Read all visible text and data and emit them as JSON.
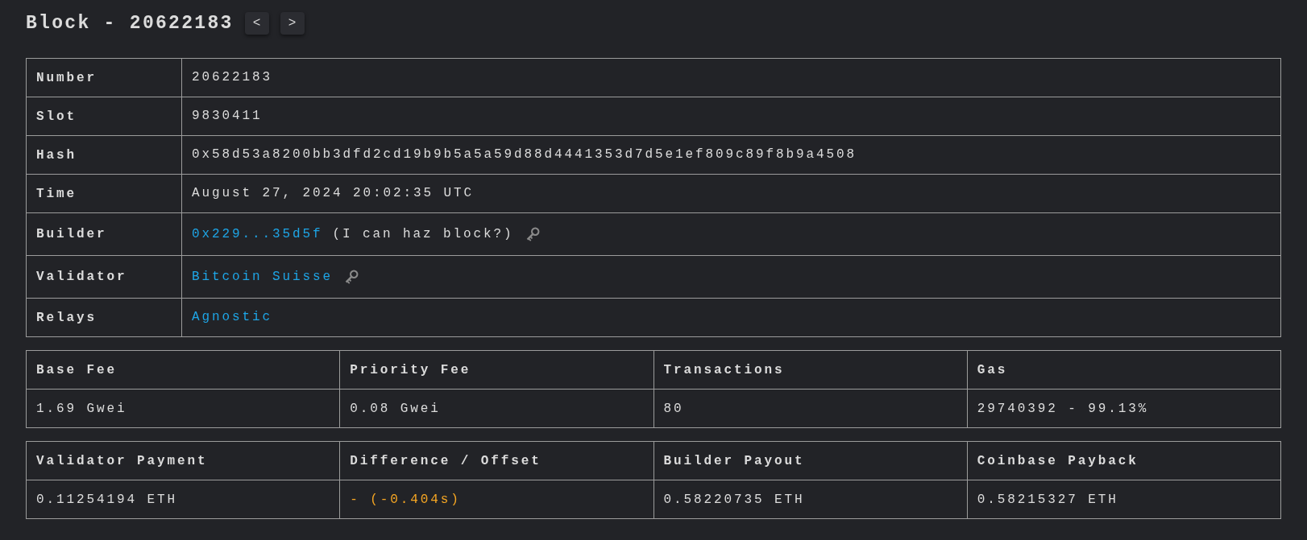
{
  "title": "Block - 20622183",
  "nav_buttons": [
    {
      "label": "<"
    },
    {
      "label": ">"
    }
  ],
  "details": [
    {
      "label": "Number",
      "parts": [
        {
          "kind": "text",
          "text": "20622183"
        }
      ],
      "key": false
    },
    {
      "label": "Slot",
      "parts": [
        {
          "kind": "text",
          "text": "9830411"
        }
      ],
      "key": false
    },
    {
      "label": "Hash",
      "parts": [
        {
          "kind": "text",
          "text": "0x58d53a8200bb3dfd2cd19b9b5a5a59d88d4441353d7d5e1ef809c89f8b9a4508"
        }
      ],
      "key": false
    },
    {
      "label": "Time",
      "parts": [
        {
          "kind": "text",
          "text": "August 27, 2024 20:02:35 UTC"
        }
      ],
      "key": false
    },
    {
      "label": "Builder",
      "parts": [
        {
          "kind": "link",
          "text": "0x229...35d5f"
        },
        {
          "kind": "text",
          "text": "(I can haz block?)"
        }
      ],
      "key": true
    },
    {
      "label": "Validator",
      "parts": [
        {
          "kind": "link",
          "text": "Bitcoin Suisse"
        }
      ],
      "key": true
    },
    {
      "label": "Relays",
      "parts": [
        {
          "kind": "link",
          "text": "Agnostic"
        }
      ],
      "key": false
    }
  ],
  "stat_tables": [
    {
      "columns": [
        {
          "header": "Base Fee",
          "value": "1.69 Gwei",
          "kind": "text"
        },
        {
          "header": "Priority Fee",
          "value": "0.08 Gwei",
          "kind": "text"
        },
        {
          "header": "Transactions",
          "value": "80",
          "kind": "text"
        },
        {
          "header": "Gas",
          "value": "29740392 - 99.13%",
          "kind": "text"
        }
      ]
    },
    {
      "columns": [
        {
          "header": "Validator Payment",
          "value": "0.11254194 ETH",
          "kind": "text"
        },
        {
          "header": "Difference / Offset",
          "value": "- (-0.404s)",
          "kind": "warning"
        },
        {
          "header": "Builder Payout",
          "value": "0.58220735 ETH",
          "kind": "text"
        },
        {
          "header": "Coinbase Payback",
          "value": "0.58215327 ETH",
          "kind": "text"
        }
      ]
    }
  ]
}
